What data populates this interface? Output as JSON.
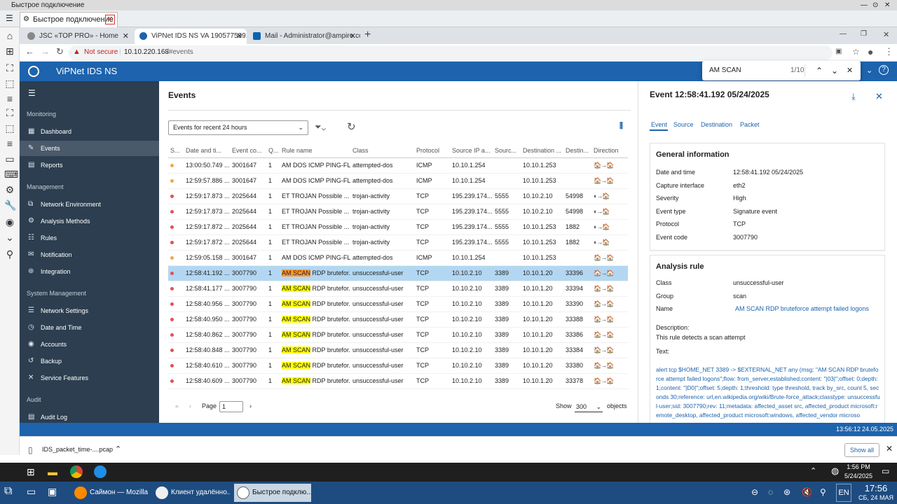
{
  "outer": {
    "title": "Быстрое подключение",
    "tab": "Быстрое подключение"
  },
  "browser": {
    "tabs": [
      {
        "label": "JSC «TOP PRO» - Home"
      },
      {
        "label": "ViPNet IDS NS VA 1905775991 - V"
      },
      {
        "label": "Mail - Administrator@ampire.com"
      }
    ],
    "not_secure": "Not secure",
    "url_host": "10.10.220.168",
    "url_path": "/#events"
  },
  "find": {
    "query": "AM SCAN",
    "count": "1/10"
  },
  "app": {
    "title": "ViPNet IDS NS"
  },
  "sidebar": {
    "monitoring": "Monitoring",
    "monitoring_items": [
      "Dashboard",
      "Events",
      "Reports"
    ],
    "management": "Management",
    "management_items": [
      "Network Environment",
      "Analysis Methods",
      "Rules",
      "Notification",
      "Integration"
    ],
    "system": "System Management",
    "system_items": [
      "Network Settings",
      "Date and Time",
      "Accounts",
      "Backup",
      "Service Features"
    ],
    "audit": "Audit",
    "audit_items": [
      "Audit Log"
    ]
  },
  "events": {
    "title": "Events",
    "period": "Events for recent 24 hours",
    "columns": [
      "S...",
      "Date and ti...",
      "Event co...",
      "Q...",
      "Rule name",
      "Class",
      "Protocol",
      "Source IP a...",
      "Sourc...",
      "Destination ...",
      "Destin...",
      "Direction"
    ],
    "rows": [
      {
        "sev": "#f4a742",
        "time": "13:00:50.749 ...",
        "code": "3001647",
        "q": "1",
        "pre": "",
        "hl": "",
        "rule": "AM DOS ICMP PING-FL...",
        "cls": "attempted-dos",
        "proto": "ICMP",
        "src": "10.10.1.254",
        "sport": "",
        "dst": "10.10.1.253",
        "dport": "",
        "dir": "🏠→🏠"
      },
      {
        "sev": "#f4a742",
        "time": "12:59:57.886 ...",
        "code": "3001647",
        "q": "1",
        "pre": "",
        "hl": "",
        "rule": "AM DOS ICMP PING-FL...",
        "cls": "attempted-dos",
        "proto": "ICMP",
        "src": "10.10.1.254",
        "sport": "",
        "dst": "10.10.1.253",
        "dport": "",
        "dir": "🏠→🏠"
      },
      {
        "sev": "#e05252",
        "time": "12:59:17.873 ...",
        "code": "2025644",
        "q": "1",
        "pre": "",
        "hl": "",
        "rule": "ET TROJAN Possible ...",
        "cls": "trojan-activity",
        "proto": "TCP",
        "src": "195.239.174....",
        "sport": "5555",
        "dst": "10.10.2.10",
        "dport": "54998",
        "dir": "◐→🏠"
      },
      {
        "sev": "#e05252",
        "time": "12:59:17.873 ...",
        "code": "2025644",
        "q": "1",
        "pre": "",
        "hl": "",
        "rule": "ET TROJAN Possible ...",
        "cls": "trojan-activity",
        "proto": "TCP",
        "src": "195.239.174....",
        "sport": "5555",
        "dst": "10.10.2.10",
        "dport": "54998",
        "dir": "◐→🏠"
      },
      {
        "sev": "#e05252",
        "time": "12:59:17.872 ...",
        "code": "2025644",
        "q": "1",
        "pre": "",
        "hl": "",
        "rule": "ET TROJAN Possible ...",
        "cls": "trojan-activity",
        "proto": "TCP",
        "src": "195.239.174....",
        "sport": "5555",
        "dst": "10.10.1.253",
        "dport": "1882",
        "dir": "◐→🏠"
      },
      {
        "sev": "#e05252",
        "time": "12:59:17.872 ...",
        "code": "2025644",
        "q": "1",
        "pre": "",
        "hl": "",
        "rule": "ET TROJAN Possible ...",
        "cls": "trojan-activity",
        "proto": "TCP",
        "src": "195.239.174....",
        "sport": "5555",
        "dst": "10.10.1.253",
        "dport": "1882",
        "dir": "◐→🏠"
      },
      {
        "sev": "#f4a742",
        "time": "12:59:05.158 ...",
        "code": "3001647",
        "q": "1",
        "pre": "",
        "hl": "",
        "rule": "AM DOS ICMP PING-FL...",
        "cls": "attempted-dos",
        "proto": "ICMP",
        "src": "10.10.1.254",
        "sport": "",
        "dst": "10.10.1.253",
        "dport": "",
        "dir": "🏠→🏠"
      },
      {
        "sev": "#e05252",
        "time": "12:58:41.192 ...",
        "code": "3007790",
        "q": "1",
        "pre": "",
        "hl": "AM SCAN",
        "rule": " RDP brutefor...",
        "cls": "unsuccessful-user",
        "proto": "TCP",
        "src": "10.10.2.10",
        "sport": "3389",
        "dst": "10.10.1.20",
        "dport": "33396",
        "dir": "🏠→🏠",
        "selected": true
      },
      {
        "sev": "#e05252",
        "time": "12:58:41.177 ...",
        "code": "3007790",
        "q": "1",
        "pre": "",
        "hl": "AM SCAN",
        "rule": " RDP brutefor...",
        "cls": "unsuccessful-user",
        "proto": "TCP",
        "src": "10.10.2.10",
        "sport": "3389",
        "dst": "10.10.1.20",
        "dport": "33394",
        "dir": "🏠→🏠"
      },
      {
        "sev": "#e05252",
        "time": "12:58:40.956 ...",
        "code": "3007790",
        "q": "1",
        "pre": "",
        "hl": "AM SCAN",
        "rule": " RDP brutefor...",
        "cls": "unsuccessful-user",
        "proto": "TCP",
        "src": "10.10.2.10",
        "sport": "3389",
        "dst": "10.10.1.20",
        "dport": "33390",
        "dir": "🏠→🏠"
      },
      {
        "sev": "#e05252",
        "time": "12:58:40.950 ...",
        "code": "3007790",
        "q": "1",
        "pre": "",
        "hl": "AM SCAN",
        "rule": " RDP brutefor...",
        "cls": "unsuccessful-user",
        "proto": "TCP",
        "src": "10.10.2.10",
        "sport": "3389",
        "dst": "10.10.1.20",
        "dport": "33388",
        "dir": "🏠→🏠"
      },
      {
        "sev": "#e05252",
        "time": "12:58:40.862 ...",
        "code": "3007790",
        "q": "1",
        "pre": "",
        "hl": "AM SCAN",
        "rule": " RDP brutefor...",
        "cls": "unsuccessful-user",
        "proto": "TCP",
        "src": "10.10.2.10",
        "sport": "3389",
        "dst": "10.10.1.20",
        "dport": "33386",
        "dir": "🏠→🏠"
      },
      {
        "sev": "#e05252",
        "time": "12:58:40.848 ...",
        "code": "3007790",
        "q": "1",
        "pre": "",
        "hl": "AM SCAN",
        "rule": " RDP brutefor...",
        "cls": "unsuccessful-user",
        "proto": "TCP",
        "src": "10.10.2.10",
        "sport": "3389",
        "dst": "10.10.1.20",
        "dport": "33384",
        "dir": "🏠→🏠"
      },
      {
        "sev": "#e05252",
        "time": "12:58:40.610 ...",
        "code": "3007790",
        "q": "1",
        "pre": "",
        "hl": "AM SCAN",
        "rule": " RDP brutefor...",
        "cls": "unsuccessful-user",
        "proto": "TCP",
        "src": "10.10.2.10",
        "sport": "3389",
        "dst": "10.10.1.20",
        "dport": "33380",
        "dir": "🏠→🏠"
      },
      {
        "sev": "#e05252",
        "time": "12:58:40.609 ...",
        "code": "3007790",
        "q": "1",
        "pre": "",
        "hl": "AM SCAN",
        "rule": " RDP brutefor...",
        "cls": "unsuccessful-user",
        "proto": "TCP",
        "src": "10.10.2.10",
        "sport": "3389",
        "dst": "10.10.1.20",
        "dport": "33378",
        "dir": "🏠→🏠"
      }
    ],
    "page_label": "Page",
    "page_value": "1",
    "show_label": "Show",
    "show_value": "300",
    "objects_label": "objects"
  },
  "detail": {
    "title": "Event 12:58:41.192 05/24/2025",
    "tabs": [
      "Event",
      "Source",
      "Destination",
      "Packet"
    ],
    "general_title": "General information",
    "general": [
      {
        "k": "Date and time",
        "v": "12:58:41.192 05/24/2025"
      },
      {
        "k": "Capture interface",
        "v": "eth2"
      },
      {
        "k": "Severity",
        "v": "High"
      },
      {
        "k": "Event type",
        "v": "Signature event"
      },
      {
        "k": "Protocol",
        "v": "TCP"
      },
      {
        "k": "Event code",
        "v": "3007790"
      }
    ],
    "rule_title": "Analysis rule",
    "rule": [
      {
        "k": "Class",
        "v": "unsuccessful-user"
      },
      {
        "k": "Group",
        "v": "scan"
      },
      {
        "k": "Name",
        "v": "AM SCAN RDP bruteforce attempt failed logons"
      }
    ],
    "description_label": "Description:",
    "description": "This rule detects a scan attempt",
    "text_label": "Text:",
    "text": "alert tcp $HOME_NET 3389 -> $EXTERNAL_NET any (msg: \"AM SCAN RDP bruteforce attempt failed logons\";flow: from_server,established;content: \"|03|\";offset: 0;depth: 1;content: \"|D0|\";offset: 5;depth: 1;threshold: type threshold, track by_src, count 5, seconds 30;reference: url,en.wikipedia.org/wiki/Brute-force_attack;classtype: unsuccessful-user;sid: 3007790;rev: 11;metadata: affected_asset src, affected_product microsoft:remote_desktop, affected_product microsoft:windows, affected_vendor microso"
  },
  "status": {
    "time": "13:56:12",
    "date": "24.05.2025"
  },
  "downloads": {
    "file": "IDS_packet_time-....pcap",
    "show_all": "Show all"
  },
  "win": {
    "time": "1:56 PM",
    "date": "5/24/2025"
  },
  "rdp_taskbar": {
    "tasks": [
      "Саймон — Mozilla ...",
      "Клиент удалённо...",
      "Быстрое подклю..."
    ],
    "lang": "EN",
    "time": "17:56",
    "date": "СБ, 24 МАЯ"
  },
  "colors": {
    "accent": "#1d63ad",
    "sidebar": "#2c3e50",
    "selected_row": "#b3d7f2"
  }
}
